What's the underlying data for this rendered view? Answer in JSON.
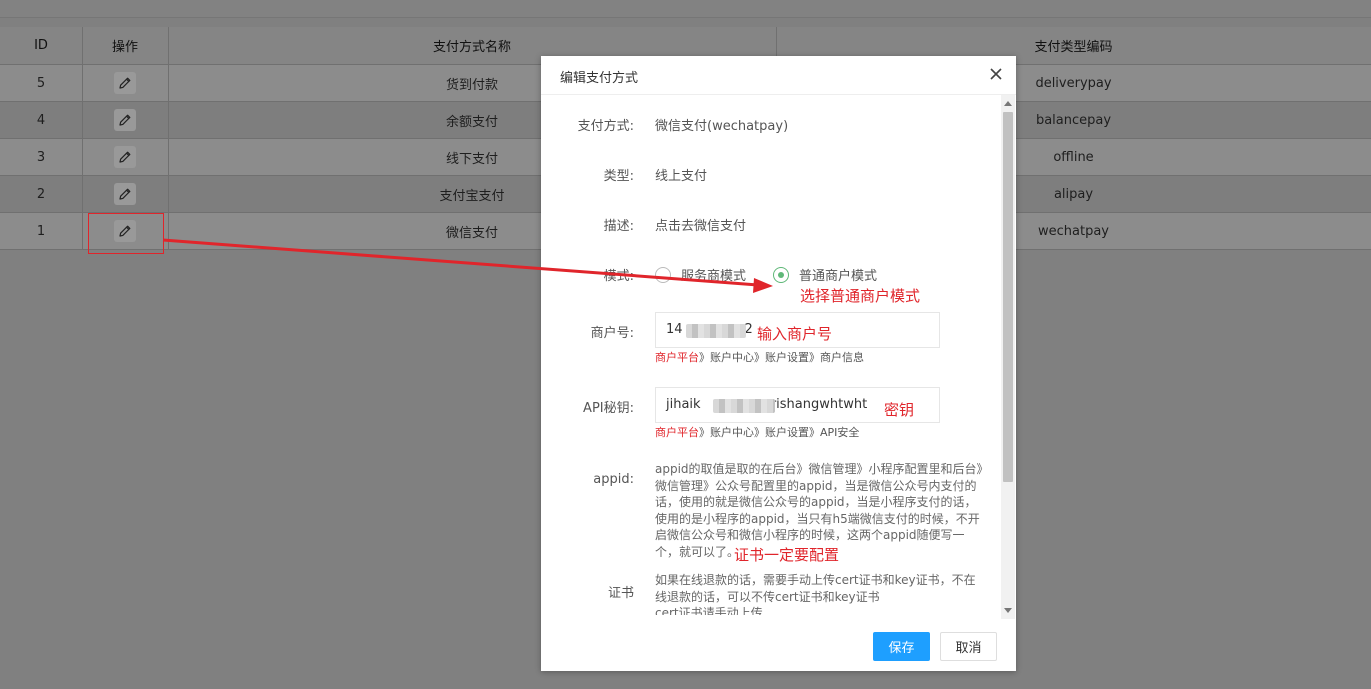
{
  "table": {
    "headers": {
      "id": "ID",
      "actions": "操作",
      "name": "支付方式名称",
      "code": "支付类型编码"
    },
    "rows": [
      {
        "id": "5",
        "name": "货到付款",
        "code": "deliverypay"
      },
      {
        "id": "4",
        "name": "余额支付",
        "code": "balancepay"
      },
      {
        "id": "3",
        "name": "线下支付",
        "code": "offline"
      },
      {
        "id": "2",
        "name": "支付宝支付",
        "code": "alipay"
      },
      {
        "id": "1",
        "name": "微信支付",
        "code": "wechatpay"
      }
    ],
    "edit_icon": "pencil-icon"
  },
  "modal": {
    "title": "编辑支付方式",
    "close_icon": "close-icon",
    "fields": {
      "payment_label": "支付方式:",
      "payment_value": "微信支付(wechatpay)",
      "type_label": "类型:",
      "type_value": "线上支付",
      "desc_label": "描述:",
      "desc_value": "点击去微信支付",
      "mode_label": "模式:",
      "mode_options": [
        {
          "label": "服务商模式",
          "selected": false
        },
        {
          "label": "普通商户模式",
          "selected": true
        }
      ],
      "merchant_label": "商户号:",
      "merchant_value_start": "14",
      "merchant_value_end": "2",
      "merchant_hint_link": "商户平台",
      "merchant_hint_rest": "》账户中心》账户设置》商户信息",
      "api_label": "API秘钥:",
      "api_value_start": "jihaik",
      "api_value_end": "grishangwhtwht",
      "api_hint_link": "商户平台",
      "api_hint_rest": "》账户中心》账户设置》API安全",
      "appid_label": "appid:",
      "appid_text": "appid的取值是取的在后台》微信管理》小程序配置里和后台》微信管理》公众号配置里的appid，当是微信公众号内支付的话，使用的就是微信公众号的appid，当是小程序支付的话，使用的是小程序的appid，当只有h5端微信支付的时候，不开启微信公众号和微信小程序的时候，这两个appid随便写一个，就可以了。",
      "cert_label": "证书",
      "cert_text_1": "如果在线退款的话，需要手动上传cert证书和key证书，不在线退款的话，可以不传cert证书和key证书",
      "cert_text_2": "cert证书请手动上传"
    },
    "save_label": "保存",
    "cancel_label": "取消"
  },
  "annotations": {
    "mode": "选择普通商户模式",
    "merchant": "输入商户号",
    "key": "密钥",
    "cert": "证书一定要配置"
  },
  "colors": {
    "annotation": "#e0252b",
    "primary_button": "#1e9fff",
    "radio_selected": "#5fb878"
  }
}
